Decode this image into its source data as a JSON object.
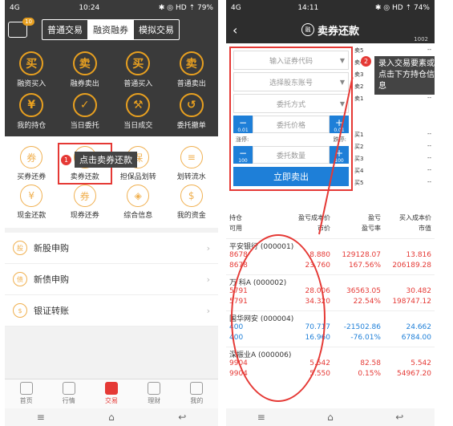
{
  "left": {
    "status": {
      "signal": "4G",
      "time": "10:24",
      "icons": "✱ ◎ HD ⇡",
      "battery": "79%"
    },
    "badge": "10",
    "tabs": [
      "普通交易",
      "融资融券",
      "模拟交易"
    ],
    "active_tab": 1,
    "top_grid": [
      [
        {
          "icon": "买",
          "label": "融资买入"
        },
        {
          "icon": "卖",
          "label": "融券卖出"
        },
        {
          "icon": "买",
          "label": "普通买入"
        },
        {
          "icon": "卖",
          "label": "普通卖出"
        }
      ],
      [
        {
          "icon": "¥",
          "label": "我的持仓"
        },
        {
          "icon": "✓",
          "label": "当日委托"
        },
        {
          "icon": "⚒",
          "label": "当日成交"
        },
        {
          "icon": "↺",
          "label": "委托撤单"
        }
      ]
    ],
    "callout": {
      "number": "1",
      "text": "点击卖券还款"
    },
    "white_grid": [
      [
        {
          "icon": "券",
          "label": "买券还券"
        },
        {
          "icon": "券",
          "label": "卖券还款"
        },
        {
          "icon": "保",
          "label": "担保品划转"
        },
        {
          "icon": "≡",
          "label": "划转流水"
        }
      ],
      [
        {
          "icon": "¥",
          "label": "现金还款"
        },
        {
          "icon": "券",
          "label": "现券还券"
        },
        {
          "icon": "◈",
          "label": "综合信息"
        },
        {
          "icon": "$",
          "label": "我的资金"
        }
      ]
    ],
    "list": [
      {
        "icon": "股",
        "label": "新股申购"
      },
      {
        "icon": "债",
        "label": "新债申购"
      },
      {
        "icon": "$",
        "label": "银证转账"
      }
    ],
    "tabbar": [
      "首页",
      "行情",
      "交易",
      "理财",
      "我的"
    ],
    "tabbar_active": 2,
    "nav": [
      "≡",
      "⌂",
      "↩"
    ]
  },
  "right": {
    "status": {
      "signal": "4G",
      "time": "14:11",
      "icons": "✱ ◎ HD ⇡",
      "battery": "74%"
    },
    "title": "卖券还款",
    "logo": "融",
    "account": "1002",
    "form": {
      "code_placeholder": "输入证券代码",
      "account_placeholder": "选择股东账号",
      "order_type": "委托方式",
      "price_placeholder": "委托价格",
      "price_step": "0.01",
      "qty_placeholder": "委托数量",
      "qty_step": "100",
      "limit_up": "涨停:",
      "limit_down": "跌停:",
      "submit": "立即卖出"
    },
    "quotes": [
      {
        "label": "卖5",
        "v": "--"
      },
      {
        "label": "卖4",
        "v": "--"
      },
      {
        "label": "卖3",
        "v": "--"
      },
      {
        "label": "卖2",
        "v": "--"
      },
      {
        "label": "卖1",
        "v": "--"
      },
      {
        "label": "",
        "v": ""
      },
      {
        "label": "",
        "v": ""
      },
      {
        "label": "买1",
        "v": "--"
      },
      {
        "label": "买2",
        "v": "--"
      },
      {
        "label": "买3",
        "v": "--"
      },
      {
        "label": "买4",
        "v": "--"
      },
      {
        "label": "买5",
        "v": "--"
      }
    ],
    "callout": {
      "number": "2",
      "text": "录入交易要素或点击下方持仓信息"
    },
    "holdings_header": [
      [
        "持仓",
        "盈亏成本价",
        "盈亏",
        "买入成本价"
      ],
      [
        "可用",
        "市价",
        "盈亏率",
        "市值"
      ]
    ],
    "holdings": [
      {
        "name": "平安银行 (000001)",
        "rows": [
          [
            "8678",
            "8.880",
            "129128.07",
            "13.816"
          ],
          [
            "8678",
            "23.760",
            "167.56%",
            "206189.28"
          ]
        ],
        "color": "red"
      },
      {
        "name": "万 科A (000002)",
        "rows": [
          [
            "5791",
            "28.006",
            "36563.05",
            "30.482"
          ],
          [
            "5791",
            "34.320",
            "22.54%",
            "198747.12"
          ]
        ],
        "color": "red"
      },
      {
        "name": "国华网安 (000004)",
        "rows": [
          [
            "400",
            "70.717",
            "-21502.86",
            "24.662"
          ],
          [
            "400",
            "16.960",
            "-76.01%",
            "6784.00"
          ]
        ],
        "color": "blue"
      },
      {
        "name": "深振业A (000006)",
        "rows": [
          [
            "9904",
            "5.542",
            "82.58",
            "5.542"
          ],
          [
            "9904",
            "5.550",
            "0.15%",
            "54967.20"
          ]
        ],
        "color": "red"
      }
    ],
    "nav": [
      "≡",
      "⌂",
      "↩"
    ]
  }
}
